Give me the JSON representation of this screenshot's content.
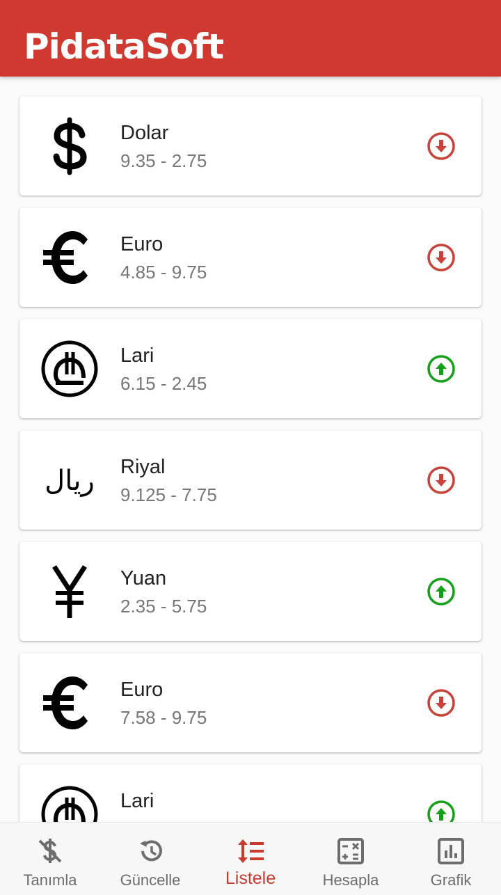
{
  "app": {
    "title": "PidataSoft"
  },
  "colors": {
    "primary": "#d0392f",
    "down": "#c9423a",
    "up": "#16a01a",
    "nav_inactive": "#6d6d6d",
    "nav_active": "#c93a2f"
  },
  "currencies": [
    {
      "name": "Dolar",
      "range": "9.35 - 2.75",
      "icon": "dollar-icon",
      "trend": "down"
    },
    {
      "name": "Euro",
      "range": "4.85 - 9.75",
      "icon": "euro-icon",
      "trend": "down"
    },
    {
      "name": "Lari",
      "range": "6.15 - 2.45",
      "icon": "lari-icon",
      "trend": "up"
    },
    {
      "name": "Riyal",
      "range": "9.125 - 7.75",
      "icon": "riyal-icon",
      "trend": "down"
    },
    {
      "name": "Yuan",
      "range": "2.35 - 5.75",
      "icon": "yuan-icon",
      "trend": "up"
    },
    {
      "name": "Euro",
      "range": "7.58 - 9.75",
      "icon": "euro-icon",
      "trend": "down"
    },
    {
      "name": "Lari",
      "range": "",
      "icon": "lari-icon",
      "trend": "up"
    }
  ],
  "bottom_nav": {
    "items": [
      {
        "label": "Tanımla",
        "icon": "money-off-icon",
        "active": false
      },
      {
        "label": "Güncelle",
        "icon": "history-icon",
        "active": false
      },
      {
        "label": "Listele",
        "icon": "sort-list-icon",
        "active": true
      },
      {
        "label": "Hesapla",
        "icon": "calculator-icon",
        "active": false
      },
      {
        "label": "Grafik",
        "icon": "chart-icon",
        "active": false
      }
    ]
  }
}
